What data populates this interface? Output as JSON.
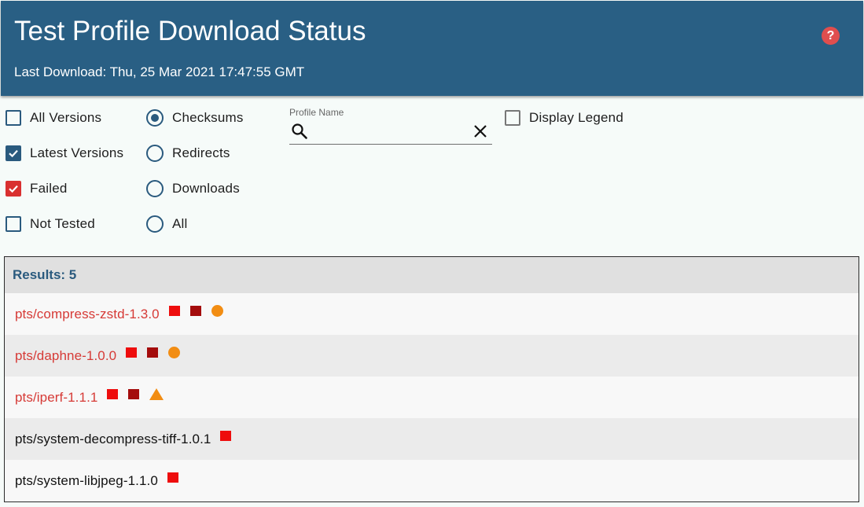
{
  "header": {
    "title": "Test Profile Download Status",
    "subtitle": "Last Download: Thu, 25 Mar 2021 17:47:55 GMT",
    "help_icon": "?"
  },
  "filters": {
    "checkboxes": [
      {
        "label": "All Versions",
        "checked": false
      },
      {
        "label": "Latest Versions",
        "checked": true
      },
      {
        "label": "Failed",
        "checked": true
      },
      {
        "label": "Not Tested",
        "checked": false
      }
    ],
    "radios": [
      {
        "label": "Checksums",
        "selected": true
      },
      {
        "label": "Redirects",
        "selected": false
      },
      {
        "label": "Downloads",
        "selected": false
      },
      {
        "label": "All",
        "selected": false
      }
    ],
    "search": {
      "label": "Profile Name",
      "value": ""
    },
    "legend": {
      "label": "Display Legend",
      "checked": false
    }
  },
  "results": {
    "header": "Results: 5",
    "rows": [
      {
        "name": "pts/compress-zstd-1.3.0",
        "status": "failed",
        "markers": [
          "red-square",
          "dark-red-square",
          "orange-circle"
        ]
      },
      {
        "name": "pts/daphne-1.0.0",
        "status": "failed",
        "markers": [
          "red-square",
          "dark-red-square",
          "orange-circle"
        ]
      },
      {
        "name": "pts/iperf-1.1.1",
        "status": "failed",
        "markers": [
          "red-square",
          "dark-red-square",
          "orange-triangle"
        ]
      },
      {
        "name": "pts/system-decompress-tiff-1.0.1",
        "status": "ok",
        "markers": [
          "red-square"
        ]
      },
      {
        "name": "pts/system-libjpeg-1.1.0",
        "status": "ok",
        "markers": [
          "red-square"
        ]
      }
    ]
  },
  "colors": {
    "header_bg": "#295f84",
    "accent": "#2a5a7e",
    "failed_text": "#d63a36",
    "marker_red": "#ee0d0d",
    "marker_dark_red": "#a40c0c",
    "marker_orange": "#f28d13"
  }
}
